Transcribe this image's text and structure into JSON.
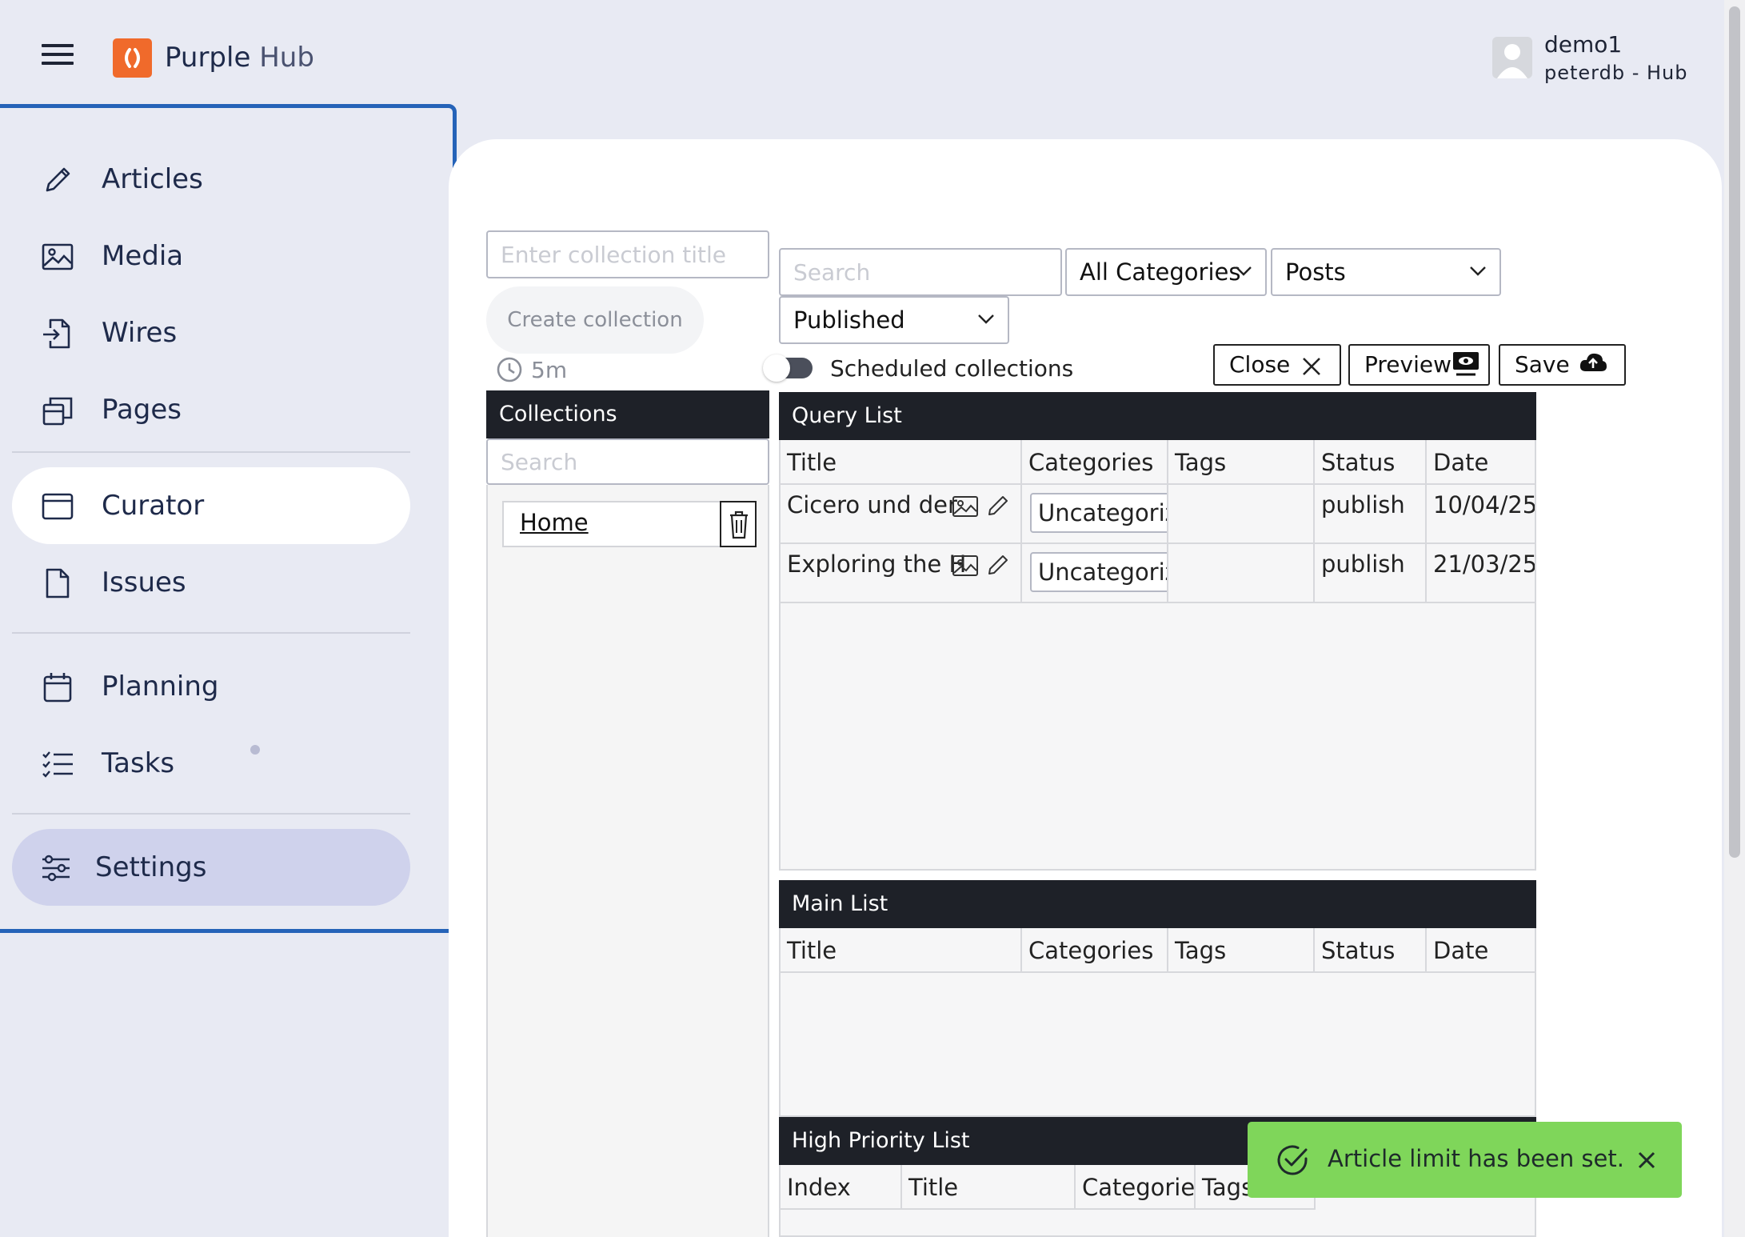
{
  "header": {
    "brand_primary": "Purple",
    "brand_secondary": "Hub",
    "user_name": "demo1",
    "user_sub": "peterdb - Hub"
  },
  "sidebar": {
    "items": [
      {
        "label": "Articles",
        "icon": "pencil-icon"
      },
      {
        "label": "Media",
        "icon": "image-icon"
      },
      {
        "label": "Wires",
        "icon": "file-import-icon"
      },
      {
        "label": "Pages",
        "icon": "pages-icon"
      },
      {
        "label": "Curator",
        "icon": "browser-window-icon"
      },
      {
        "label": "Issues",
        "icon": "document-icon"
      },
      {
        "label": "Planning",
        "icon": "calendar-icon"
      },
      {
        "label": "Tasks",
        "icon": "checklist-icon"
      },
      {
        "label": "Settings",
        "icon": "sliders-icon"
      }
    ],
    "active": "Curator"
  },
  "collections": {
    "title_placeholder": "Enter collection title",
    "create_label": "Create collection",
    "timer": "5m",
    "header": "Collections",
    "search_placeholder": "Search",
    "items": [
      "Home"
    ]
  },
  "filters": {
    "search_placeholder": "Search",
    "category": "All Categories",
    "type": "Posts",
    "status": "Published",
    "scheduled_label": "Scheduled collections"
  },
  "actions": {
    "close": "Close",
    "preview": "Preview",
    "save": "Save"
  },
  "query_list": {
    "title": "Query List",
    "columns": [
      "Title",
      "Categories",
      "Tags",
      "Status",
      "Date"
    ],
    "rows": [
      {
        "title": "Cicero und der",
        "category": "Uncategorized",
        "tags": "",
        "status": "publish",
        "date": "10/04/25"
      },
      {
        "title": "Exploring the H",
        "category": "Uncategorized",
        "tags": "",
        "status": "publish",
        "date": "21/03/25"
      }
    ]
  },
  "main_list": {
    "title": "Main List",
    "columns": [
      "Title",
      "Categories",
      "Tags",
      "Status",
      "Date"
    ]
  },
  "high_priority_list": {
    "title": "High Priority List",
    "columns": [
      "Index",
      "Title",
      "Categories",
      "Tags"
    ]
  },
  "toast": {
    "message": "Article limit has been set.",
    "color": "#7fd65a"
  },
  "colors": {
    "accent_border": "#2563b8",
    "logo": "#f06a2b",
    "table_header": "#1e2128"
  }
}
